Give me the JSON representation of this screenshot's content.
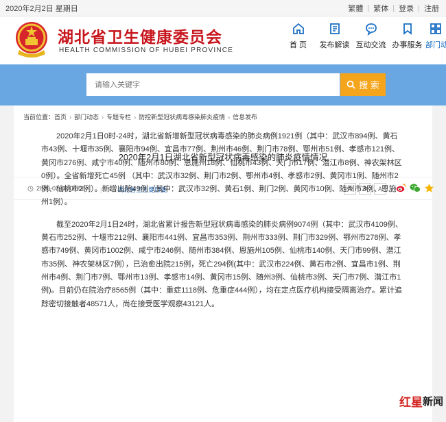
{
  "topbar": {
    "date": "2020年2月2日 星期日",
    "links": [
      "繁體",
      "繁体",
      "登录",
      "注册"
    ]
  },
  "header": {
    "title": "湖北省卫生健康委员会",
    "subtitle": "HEALTH COMMISSION OF HUBEI PROVINCE",
    "nav": [
      {
        "label": "首 页",
        "icon": "home-icon"
      },
      {
        "label": "发布解读",
        "icon": "document-icon"
      },
      {
        "label": "互动交流",
        "icon": "chat-icon"
      },
      {
        "label": "办事服务",
        "icon": "folder-icon"
      },
      {
        "label": "部门动",
        "icon": "grid-icon"
      }
    ]
  },
  "search": {
    "placeholder": "请输入关键字",
    "button": "搜 索"
  },
  "breadcrumb": {
    "prefix": "当前位置：",
    "items": [
      "首页",
      "部门动态",
      "专题专栏",
      "防控新型冠状病毒感染肺炎疫情",
      "信息发布"
    ]
  },
  "article": {
    "title": "2020年2月1日湖北省新型冠状病毒感染的肺炎疫情情况",
    "date": "2020-02-02 06:06",
    "source": "湖北省卫生健康委",
    "font_sizes": [
      "A",
      "A",
      "A"
    ],
    "paragraphs": [
      "2020年2月1日0时-24时，湖北省新增新型冠状病毒感染的肺炎病例1921例（其中：武汉市894例、黄石市43例、十堰市35例、襄阳市94例、宜昌市77例、荆州市46例、荆门市78例、鄂州市51例、孝感市121例、黄冈市276例、咸宁市40例、随州市80例、恩施州18例、仙桃市43例、天门市17例、潜江市8例、神农架林区0例）。全省新增死亡45例 （其中：武汉市32例、荆门市2例、鄂州市4例、孝感市2例、黄冈市1例、随州市2例、仙桃市2例）。新增出院49例（其中：武汉市32例、黄石1例、荆门2例、黄冈市10例、随州市3例、恩施州1例）。",
      "截至2020年2月1日24时，湖北省累计报告新型冠状病毒感染的肺炎病例9074例（其中：武汉市4109例、黄石市252例、十堰市212例、襄阳市441例、宜昌市353例、荆州市333例、荆门市329例、鄂州市278例、孝感市749例、黄冈市1002例、咸宁市246例、随州市384例、恩施州105例、仙桃市140例、天门市99例、潜江市35例、神农架林区7例），已治愈出院215例，死亡294例(其中：武汉市224例、黄石市2例、宜昌市1例、荆州市4例、荆门市7例、鄂州市13例、孝感市14例、黄冈市15例、随州3例、仙桃市3例、天门市7例、潜江市1例)。目前仍在院治疗8565例（其中：重症1118例、危重症444例），均在定点医疗机构接受隔离治疗。累计追踪密切接触者48571人，尚在接受医学观察43121人。"
    ]
  },
  "watermark": {
    "red": "红星",
    "black": "新闻"
  },
  "colors": {
    "brand_red": "#c8161d",
    "search_band": "#69a7e3",
    "search_button": "#f5a51b",
    "nav_icon": "#1a6fc4"
  }
}
